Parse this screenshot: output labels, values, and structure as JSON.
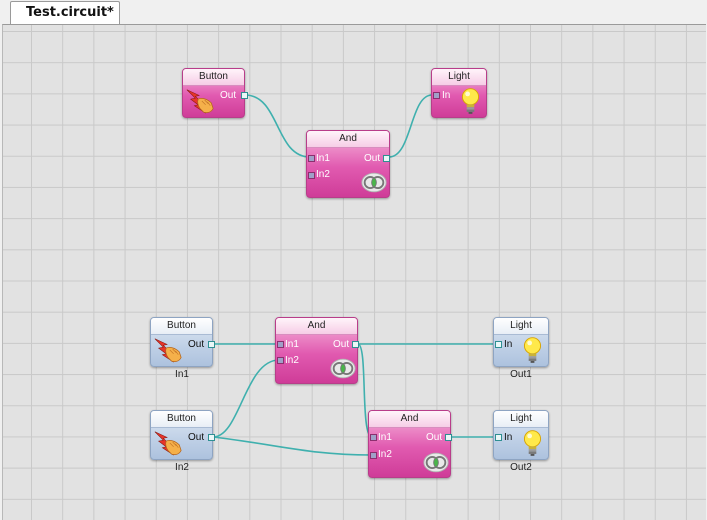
{
  "tab": {
    "title": "Test.circuit*"
  },
  "nodes": {
    "button_a": {
      "title": "Button",
      "out": "Out"
    },
    "and_a": {
      "title": "And",
      "in1": "In1",
      "in2": "In2",
      "out": "Out"
    },
    "light_a": {
      "title": "Light",
      "in": "In"
    },
    "button_in1": {
      "title": "Button",
      "out": "Out",
      "caption": "In1"
    },
    "button_in2": {
      "title": "Button",
      "out": "Out",
      "caption": "In2"
    },
    "and_b": {
      "title": "And",
      "in1": "In1",
      "in2": "In2",
      "out": "Out"
    },
    "and_c": {
      "title": "And",
      "in1": "In1",
      "in2": "In2",
      "out": "Out"
    },
    "light_out1": {
      "title": "Light",
      "in": "In",
      "caption": "Out1"
    },
    "light_out2": {
      "title": "Light",
      "in": "In",
      "caption": "Out2"
    }
  },
  "icons": {
    "button": "lightning-hand-icon",
    "light": "light-bulb-icon",
    "and": "and-gate-icon"
  },
  "colors": {
    "wire": "#3fb0ae",
    "node_pink": "#e15ab0",
    "node_blue": "#bfd0e6"
  }
}
